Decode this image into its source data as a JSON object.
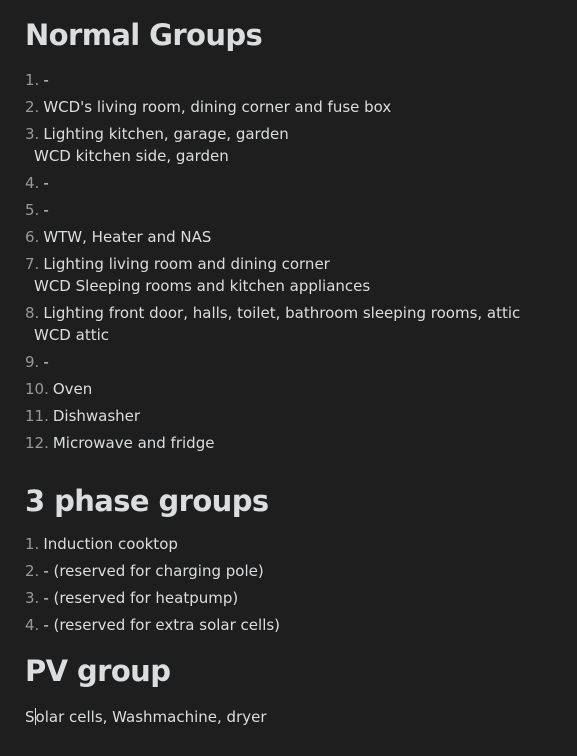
{
  "sections": {
    "normal": {
      "title": "Normal Groups",
      "items": [
        {
          "num": "1.",
          "line1": "-",
          "line2": ""
        },
        {
          "num": "2.",
          "line1": "WCD's living room, dining corner and fuse box",
          "line2": ""
        },
        {
          "num": "3.",
          "line1": "Lighting kitchen, garage, garden",
          "line2": "WCD kitchen side, garden"
        },
        {
          "num": "4.",
          "line1": "-",
          "line2": ""
        },
        {
          "num": "5.",
          "line1": "-",
          "line2": ""
        },
        {
          "num": "6.",
          "line1": "WTW, Heater and NAS",
          "line2": ""
        },
        {
          "num": "7.",
          "line1": "Lighting living room and dining corner",
          "line2": "WCD Sleeping rooms and kitchen appliances"
        },
        {
          "num": "8.",
          "line1": "Lighting front door, halls, toilet, bathroom sleeping rooms, attic",
          "line2": "WCD attic"
        },
        {
          "num": "9.",
          "line1": "-",
          "line2": ""
        },
        {
          "num": "10.",
          "line1": "Oven",
          "line2": ""
        },
        {
          "num": "11.",
          "line1": "Dishwasher",
          "line2": ""
        },
        {
          "num": "12.",
          "line1": "Microwave and fridge",
          "line2": ""
        }
      ]
    },
    "three_phase": {
      "title": "3 phase groups",
      "items": [
        {
          "num": "1.",
          "line1": "Induction cooktop"
        },
        {
          "num": "2.",
          "line1": "- (reserved for charging pole)"
        },
        {
          "num": "3.",
          "line1": "- (reserved for heatpump)"
        },
        {
          "num": "4.",
          "line1": "- (reserved for extra solar cells)"
        }
      ]
    },
    "pv": {
      "title": "PV group",
      "text_before_caret": "S",
      "text_after_caret": "olar cells, Washmachine, dryer"
    }
  }
}
